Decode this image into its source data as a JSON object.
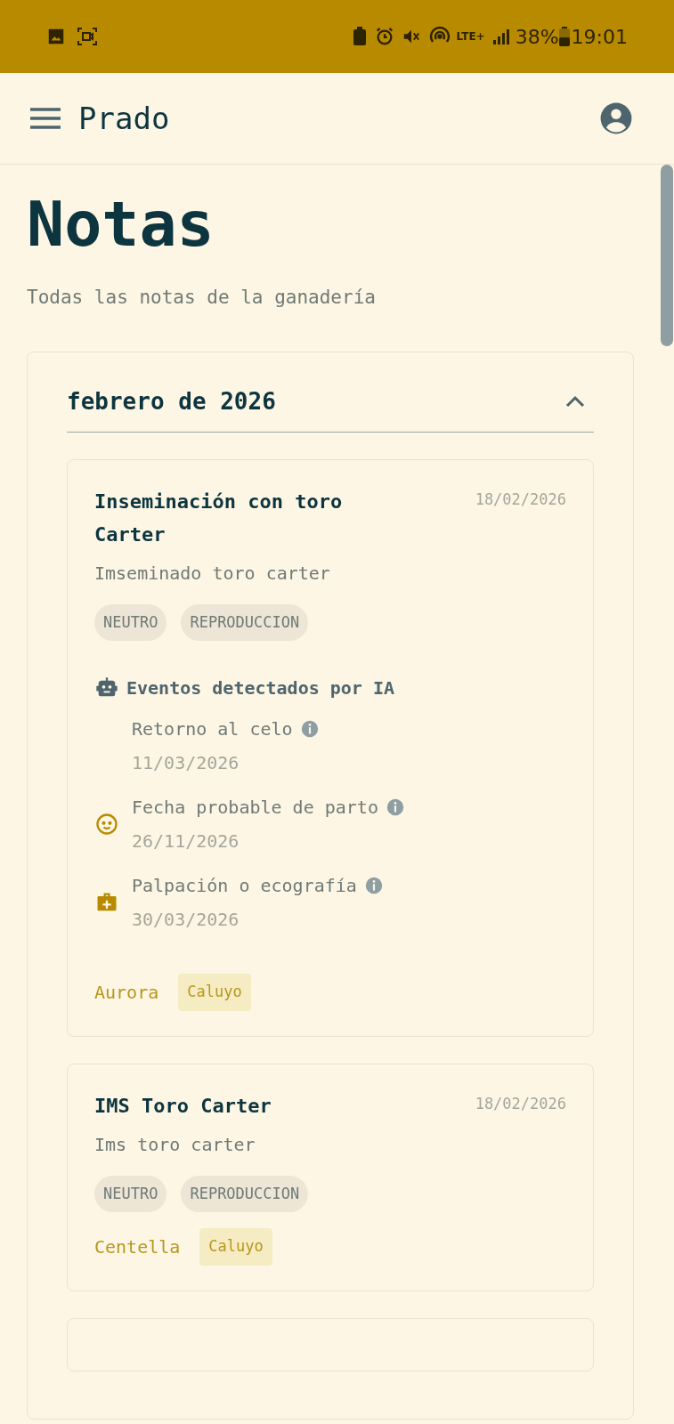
{
  "status_bar": {
    "network": "LTE+",
    "battery": "38%",
    "time": "19:01"
  },
  "app_bar": {
    "title": "Prado"
  },
  "page": {
    "title": "Notas",
    "subtitle": "Todas las notas de la ganadería"
  },
  "section": {
    "title": "febrero de 2026",
    "expanded": true,
    "notes": [
      {
        "title": "Inseminación con toro Carter",
        "date": "18/02/2026",
        "body": "Imseminado toro carter",
        "tags": [
          "NEUTRO",
          "REPRODUCCION"
        ],
        "ai_heading": "Eventos detectados por IA",
        "events": [
          {
            "kind": "heat",
            "label": "Retorno al celo",
            "date": "11/03/2026"
          },
          {
            "kind": "birth",
            "label": "Fecha probable de parto",
            "date": "26/11/2026"
          },
          {
            "kind": "checkup",
            "label": "Palpación o ecografía",
            "date": "30/03/2026"
          }
        ],
        "animal": "Aurora",
        "group": "Caluyo"
      },
      {
        "title": "IMS Toro Carter",
        "date": "18/02/2026",
        "body": "Ims toro carter",
        "tags": [
          "NEUTRO",
          "REPRODUCCION"
        ],
        "animal": "Centella",
        "group": "Caluyo"
      }
    ]
  }
}
